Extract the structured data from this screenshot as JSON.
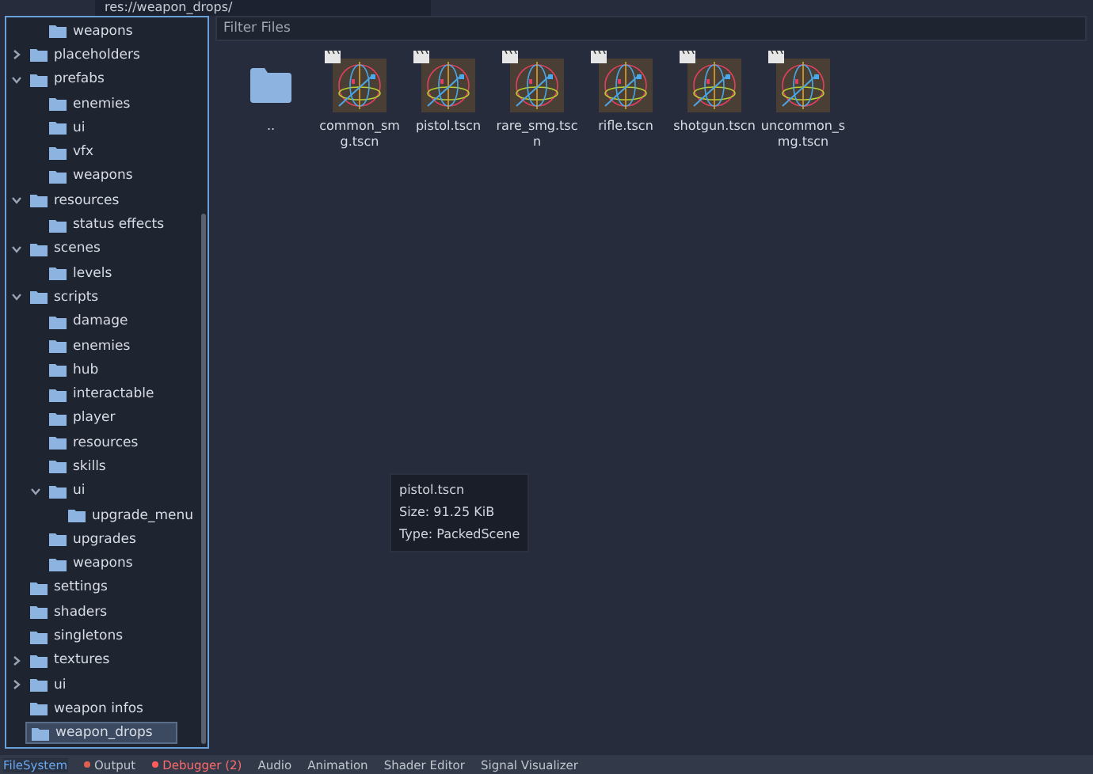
{
  "path_bar": {
    "value": "res://weapon_drops/"
  },
  "tree": [
    {
      "children": [
        {
          "label": "weapons",
          "selected": false
        }
      ]
    },
    {
      "label": "placeholders",
      "expanded": false,
      "selected": false
    },
    {
      "label": "prefabs",
      "expanded": true,
      "selected": false,
      "children": [
        {
          "label": "enemies",
          "selected": false
        },
        {
          "label": "ui",
          "selected": false
        },
        {
          "label": "vfx",
          "selected": false
        },
        {
          "label": "weapons",
          "selected": false
        }
      ]
    },
    {
      "label": "resources",
      "expanded": true,
      "selected": false,
      "children": [
        {
          "label": "status effects",
          "selected": false
        }
      ]
    },
    {
      "label": "scenes",
      "expanded": true,
      "selected": false,
      "children": [
        {
          "label": "levels",
          "selected": false
        }
      ]
    },
    {
      "label": "scripts",
      "expanded": true,
      "selected": false,
      "children": [
        {
          "label": "damage",
          "selected": false
        },
        {
          "label": "enemies",
          "selected": false
        },
        {
          "label": "hub",
          "selected": false
        },
        {
          "label": "interactable",
          "selected": false
        },
        {
          "label": "player",
          "selected": false
        },
        {
          "label": "resources",
          "selected": false
        },
        {
          "label": "skills",
          "selected": false
        },
        {
          "label": "ui",
          "expanded": true,
          "selected": false,
          "children": [
            {
              "label": "upgrade_menu",
              "selected": false
            }
          ]
        },
        {
          "label": "upgrades",
          "selected": false
        },
        {
          "label": "weapons",
          "selected": false
        }
      ]
    },
    {
      "label": "settings",
      "selected": false
    },
    {
      "label": "shaders",
      "selected": false
    },
    {
      "label": "singletons",
      "selected": false
    },
    {
      "label": "textures",
      "expanded": false,
      "selected": false
    },
    {
      "label": "ui",
      "expanded": false,
      "selected": false
    },
    {
      "label": "weapon infos",
      "selected": false
    },
    {
      "label": "weapon_drops",
      "selected": true
    }
  ],
  "filter": {
    "placeholder": "Filter Files"
  },
  "files": [
    {
      "name": "..",
      "kind": "folder"
    },
    {
      "name": "common_smg.tscn",
      "kind": "scene"
    },
    {
      "name": "pistol.tscn",
      "kind": "scene"
    },
    {
      "name": "rare_smg.tscn",
      "kind": "scene"
    },
    {
      "name": "rifle.tscn",
      "kind": "scene"
    },
    {
      "name": "shotgun.tscn",
      "kind": "scene"
    },
    {
      "name": "uncommon_smg.tscn",
      "kind": "scene"
    }
  ],
  "tooltip": {
    "lines": [
      "pistol.tscn",
      "Size: 91.25 KiB",
      "Type: PackedScene"
    ]
  },
  "bottom_tabs": [
    {
      "label": "FileSystem",
      "selected": true
    },
    {
      "label": "Output",
      "selected": false,
      "color": "#e0604f"
    },
    {
      "label": "Debugger (2)",
      "selected": false,
      "color": "#ff5d5d",
      "kind": "error"
    },
    {
      "label": "Audio",
      "selected": false
    },
    {
      "label": "Animation",
      "selected": false
    },
    {
      "label": "Shader Editor",
      "selected": false
    },
    {
      "label": "Signal Visualizer",
      "selected": false
    }
  ]
}
